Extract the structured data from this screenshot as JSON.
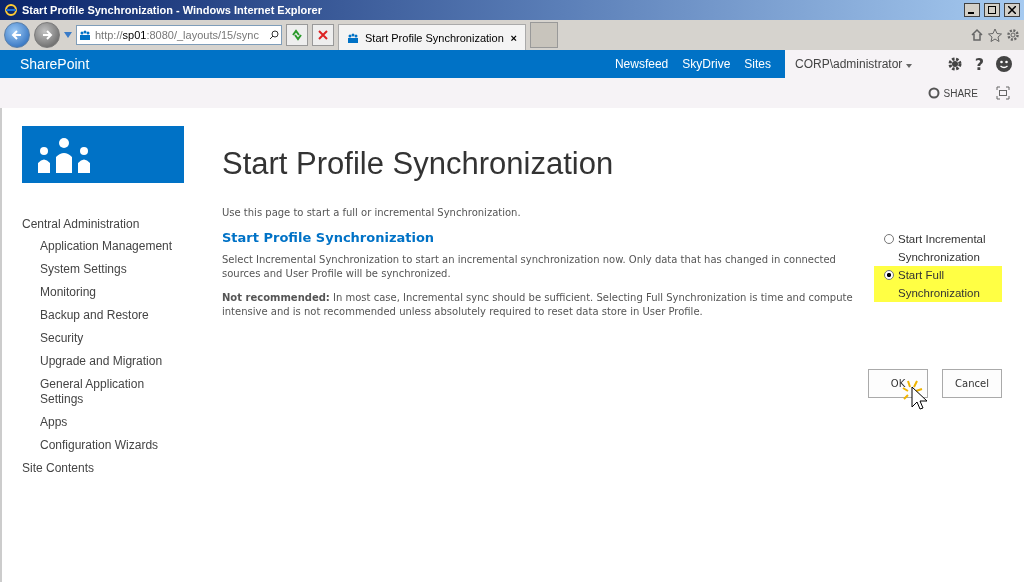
{
  "window": {
    "title": "Start Profile Synchronization - Windows Internet Explorer"
  },
  "browser": {
    "address": "http://**sp01**:8080/_layouts/15/sync",
    "tabs": [
      {
        "label": "Start Profile Synchronization",
        "selected": true
      }
    ],
    "close_tab": "×"
  },
  "suite_bar": {
    "brand": "SharePoint",
    "links": [
      "Newsfeed",
      "SkyDrive",
      "Sites"
    ],
    "user": "CORP\\administrator",
    "help": "?"
  },
  "ribbon": {
    "share": "SHARE"
  },
  "sidebar": {
    "items": [
      {
        "label": "Central Administration",
        "children": [
          {
            "label": "Application Management"
          },
          {
            "label": "System Settings"
          },
          {
            "label": "Monitoring"
          },
          {
            "label": "Backup and Restore"
          },
          {
            "label": "Security"
          },
          {
            "label": "Upgrade and Migration"
          },
          {
            "label": "General Application Settings"
          },
          {
            "label": "Apps"
          },
          {
            "label": "Configuration Wizards"
          }
        ]
      },
      {
        "label": "Site Contents"
      }
    ]
  },
  "page": {
    "title": "Start Profile Synchronization",
    "intro": "Use this page to start a full or incremental Synchronization.",
    "section": {
      "heading": "Start Profile Synchronization",
      "description": "Select Incremental Synchronization to start an incremental synchronization now. Only data that has changed in connected sources and User Profile will be synchronized.",
      "note": "**Not recommended:** In most case, Incremental sync should be sufficient. Selecting Full Synchronization is time and compute intensive and is not recommended unless absolutely required to reset data store in User Profile."
    },
    "options": [
      {
        "label": "Start Incremental Synchronization",
        "selected": false,
        "highlighted": false
      },
      {
        "label": "Start Full Synchronization",
        "selected": true,
        "highlighted": true
      }
    ],
    "buttons": [
      "OK",
      "Cancel"
    ]
  }
}
